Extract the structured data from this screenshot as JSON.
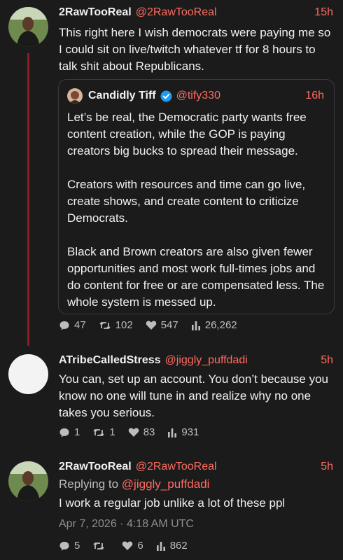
{
  "tweets": [
    {
      "name": "2RawTooReal",
      "handle": "@2RawTooReal",
      "time": "15h",
      "text": "This right here I wish democrats were paying me so I could sit on live/twitch whatever tf  for 8 hours to talk shit about Republicans.",
      "quote": {
        "name": "Candidly Tiff",
        "handle": "@tify330",
        "time": "16h",
        "paragraphs": [
          "Let’s be real, the Democratic party wants free content creation, while the GOP is paying creators big bucks to spread their message.",
          "Creators with resources and time can go live, create shows, and create content to criticize Democrats.",
          "Black and Brown creators are also given fewer opportunities and most work full-times jobs and do content for free or are compensated less. The whole system is messed up."
        ]
      },
      "stats": {
        "replies": "47",
        "retweets": "102",
        "likes": "547",
        "views": "26,262"
      }
    },
    {
      "name": "ATribeCalledStress",
      "handle": "@jiggly_puffdadi",
      "time": "5h",
      "text": "You can, set up an account. You don’t because you know no one will tune in and realize why no one takes you serious.",
      "stats": {
        "replies": "1",
        "retweets": "1",
        "likes": "83",
        "views": "931"
      }
    },
    {
      "name": "2RawTooReal",
      "handle": "@2RawTooReal",
      "time": "5h",
      "replying_label": "Replying to",
      "replying_handle": "@jiggly_puffdadi",
      "text": "I work a regular job unlike a lot of these ppl",
      "date": "Apr 7, 2026 · 4:18 AM UTC",
      "stats": {
        "replies": "5",
        "retweets": "",
        "likes": "6",
        "views": "862"
      }
    }
  ],
  "colors": {
    "accent": "#ff6b5f",
    "thread": "#8a1e24",
    "background": "#1c1b1c"
  }
}
